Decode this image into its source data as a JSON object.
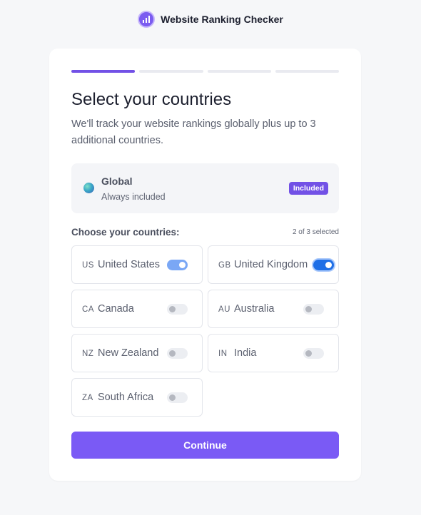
{
  "app": {
    "name": "Website Ranking Checker"
  },
  "progress": {
    "current_step": 1,
    "total_steps": 4
  },
  "page": {
    "title": "Select your countries",
    "subtitle": "We'll track your website rankings globally plus up to 3 additional countries."
  },
  "global": {
    "title": "Global",
    "subtitle": "Always included",
    "badge": "Included"
  },
  "countries_section": {
    "label": "Choose your countries:",
    "selected_text": "2 of 3 selected",
    "items": [
      {
        "code": "US",
        "name": "United States",
        "selected": true
      },
      {
        "code": "GB",
        "name": "United Kingdom",
        "selected": true
      },
      {
        "code": "CA",
        "name": "Canada",
        "selected": false
      },
      {
        "code": "AU",
        "name": "Australia",
        "selected": false
      },
      {
        "code": "NZ",
        "name": "New Zealand",
        "selected": false
      },
      {
        "code": "IN",
        "name": "India",
        "selected": false
      },
      {
        "code": "ZA",
        "name": "South Africa",
        "selected": false
      }
    ]
  },
  "actions": {
    "continue_label": "Continue"
  },
  "colors": {
    "accent": "#7251e6",
    "button": "#7a5af5",
    "toggle_on": "#1f6fe6",
    "toggle_on_light": "#7aa7f5",
    "page_bg": "#f6f7f9"
  },
  "icons": {
    "brand": "bar-chart-logo-icon",
    "global": "globe-icon"
  }
}
